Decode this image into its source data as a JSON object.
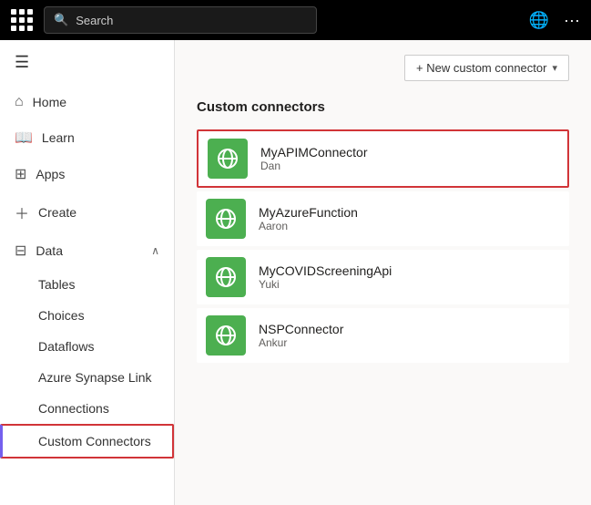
{
  "topbar": {
    "search_placeholder": "Search",
    "search_value": "Search",
    "globe_icon": "🌐",
    "more_icon": "···"
  },
  "sidebar": {
    "hamburger_label": "☰",
    "items": [
      {
        "id": "home",
        "label": "Home",
        "icon": "⌂"
      },
      {
        "id": "learn",
        "label": "Learn",
        "icon": "📖"
      },
      {
        "id": "apps",
        "label": "Apps",
        "icon": "⊞"
      },
      {
        "id": "create",
        "label": "Create",
        "icon": "+"
      },
      {
        "id": "data",
        "label": "Data",
        "icon": "⊟",
        "expanded": true
      }
    ],
    "sub_items": [
      {
        "id": "tables",
        "label": "Tables"
      },
      {
        "id": "choices",
        "label": "Choices"
      },
      {
        "id": "dataflows",
        "label": "Dataflows"
      },
      {
        "id": "azure-synapse",
        "label": "Azure Synapse Link"
      },
      {
        "id": "connections",
        "label": "Connections"
      },
      {
        "id": "custom-connectors",
        "label": "Custom Connectors"
      }
    ]
  },
  "content": {
    "new_connector_btn": "+ New custom connector",
    "new_connector_chevron": "▾",
    "section_title": "Custom connectors",
    "connectors": [
      {
        "id": "myapim",
        "name": "MyAPIMConnector",
        "author": "Dan",
        "selected": true
      },
      {
        "id": "myazure",
        "name": "MyAzureFunction",
        "author": "Aaron",
        "selected": false
      },
      {
        "id": "mycovid",
        "name": "MyCOVIDScreeningApi",
        "author": "Yuki",
        "selected": false
      },
      {
        "id": "nsp",
        "name": "NSPConnector",
        "author": "Ankur",
        "selected": false
      }
    ]
  }
}
